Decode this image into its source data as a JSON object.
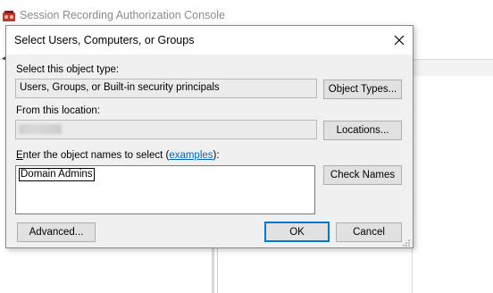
{
  "background_window": {
    "title": "Session Recording Authorization Console",
    "app_icon": "console-app-icon"
  },
  "dialog": {
    "title": "Select Users, Computers, or Groups",
    "close_icon": "close-icon",
    "object_type": {
      "label": "Select this object type:",
      "value": "Users, Groups, or Built-in security principals",
      "button": "Object Types..."
    },
    "location": {
      "label": "From this location:",
      "value": "",
      "button": "Locations..."
    },
    "names": {
      "label_prefix": "nter the object names to select (",
      "label_accel": "E",
      "link": "examples",
      "label_suffix": "):",
      "value": "Domain Admins",
      "button": "Check Names"
    },
    "buttons": {
      "advanced": "Advanced...",
      "ok": "OK",
      "cancel": "Cancel"
    }
  }
}
